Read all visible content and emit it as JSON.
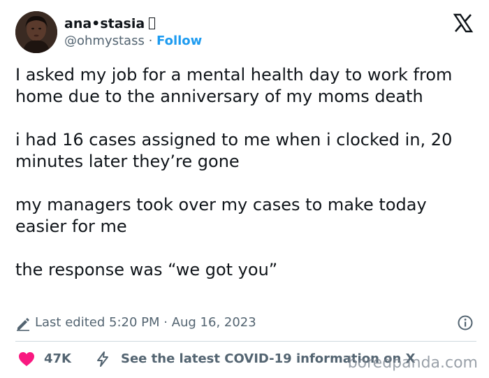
{
  "author": {
    "display_name": "ana•stasia",
    "handle": "@ohmystass",
    "separator": " · ",
    "follow_label": "Follow",
    "avatar_icon": "profile-photo"
  },
  "platform_icon": "x-logo-icon",
  "tweet": {
    "paragraphs": [
      "I asked my job for a mental health day to work from home due to the anniversary of my moms death",
      "i had 16 cases assigned to me when i clocked in, 20 minutes later they’re gone",
      "my managers took over my cases to make today easier for me",
      "the response was “we got you”"
    ]
  },
  "meta": {
    "edited_label": "Last edited 5:20 PM · Aug 16, 2023",
    "pencil_icon": "pencil-icon",
    "info_icon": "info-icon"
  },
  "actions": {
    "like_count": "47K",
    "covid_text": "See the latest COVID-19 information on X",
    "heart_color": "#f91880",
    "muted_color": "#536471",
    "accent_color": "#1d9bf0"
  },
  "watermark": "boredpanda.com"
}
